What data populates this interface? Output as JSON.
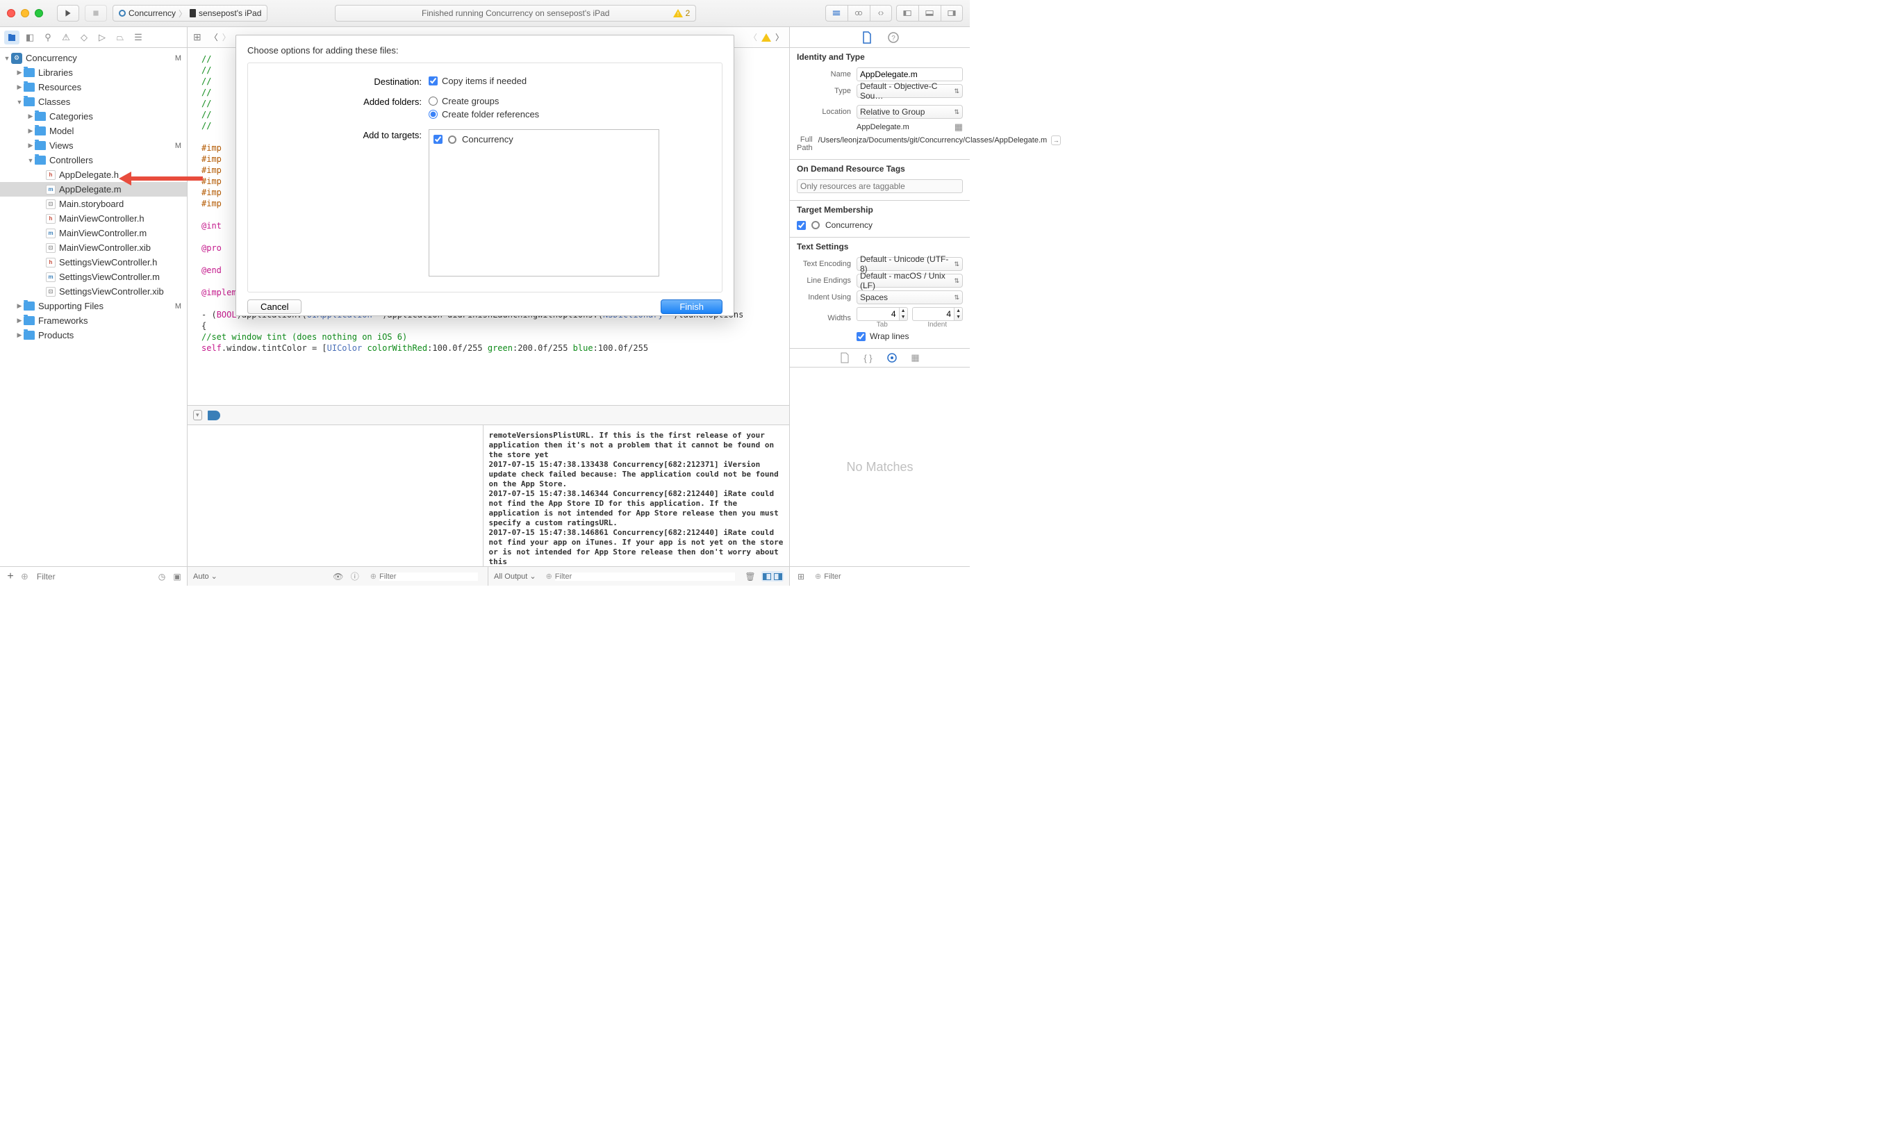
{
  "titlebar": {
    "scheme_target": "Concurrency",
    "scheme_device": "sensepost's iPad",
    "status": "Finished running Concurrency on sensepost's iPad",
    "warning_count": "2"
  },
  "navigator": {
    "project": "Concurrency",
    "project_status": "M",
    "items": [
      {
        "name": "Libraries",
        "level": 1,
        "disclosure": "▶",
        "type": "folder"
      },
      {
        "name": "Resources",
        "level": 1,
        "disclosure": "▶",
        "type": "folder"
      },
      {
        "name": "Classes",
        "level": 1,
        "disclosure": "▼",
        "type": "folder"
      },
      {
        "name": "Categories",
        "level": 2,
        "disclosure": "▶",
        "type": "folder"
      },
      {
        "name": "Model",
        "level": 2,
        "disclosure": "▶",
        "type": "folder"
      },
      {
        "name": "Views",
        "level": 2,
        "disclosure": "▶",
        "type": "folder",
        "status": "M"
      },
      {
        "name": "Controllers",
        "level": 2,
        "disclosure": "▼",
        "type": "folder"
      },
      {
        "name": "AppDelegate.h",
        "level": 3,
        "type": "h"
      },
      {
        "name": "AppDelegate.m",
        "level": 3,
        "type": "m",
        "selected": true
      },
      {
        "name": "Main.storyboard",
        "level": 3,
        "type": "x"
      },
      {
        "name": "MainViewController.h",
        "level": 3,
        "type": "h"
      },
      {
        "name": "MainViewController.m",
        "level": 3,
        "type": "m"
      },
      {
        "name": "MainViewController.xib",
        "level": 3,
        "type": "x"
      },
      {
        "name": "SettingsViewController.h",
        "level": 3,
        "type": "h"
      },
      {
        "name": "SettingsViewController.m",
        "level": 3,
        "type": "m"
      },
      {
        "name": "SettingsViewController.xib",
        "level": 3,
        "type": "x"
      },
      {
        "name": "Supporting Files",
        "level": 1,
        "disclosure": "▶",
        "type": "folder",
        "status": "M"
      },
      {
        "name": "Frameworks",
        "level": 1,
        "disclosure": "▶",
        "type": "folder"
      },
      {
        "name": "Products",
        "level": 1,
        "disclosure": "▶",
        "type": "folder"
      }
    ],
    "filter_placeholder": "Filter"
  },
  "dialog": {
    "title": "Choose options for adding these files:",
    "destination_label": "Destination:",
    "copy_items": "Copy items if needed",
    "added_folders_label": "Added folders:",
    "create_groups": "Create groups",
    "create_refs": "Create folder references",
    "add_targets_label": "Add to targets:",
    "target": "Concurrency",
    "cancel": "Cancel",
    "finish": "Finish"
  },
  "editor": {
    "lines": "//\n//\n//\n//\n//\n//\n//\n\n#imp\n#imp\n#imp\n#imp\n#imp\n#imp\n\n@int\n\n@pro\n\n@end\n\n@implementation AppDelegate\n\n",
    "method_sig_1": "- (",
    "type_bool": "BOOL",
    "method_sig_2": ")application:(",
    "type_uiapp": "UIApplication",
    "method_sig_3": " *)application didFinishLaunchingWithOptions:(",
    "type_nsdict": "NSDictionary",
    "method_sig_4": " *)launchOptions",
    "brace": "{",
    "comment_tint": "    //set window tint (does nothing on iOS 6)",
    "tint_1": "    ",
    "tint_self": "self",
    "tint_2": ".window.tintColor = [",
    "tint_uicolor": "UIColor",
    "tint_3": " ",
    "tint_method": "colorWithRed",
    "tint_4": ":100.0f/255 ",
    "tint_green": "green",
    "tint_5": ":200.0f/255 ",
    "tint_blue": "blue",
    "tint_6": ":100.0f/255"
  },
  "debug": {
    "auto_label": "Auto ⌄",
    "vars_filter": "Filter",
    "output_label": "All Output ⌄",
    "console_filter": "Filter",
    "console": "remoteVersionsPlistURL. If this is the first release of your application then it's not a problem that it cannot be found on the store yet\n2017-07-15 15:47:38.133438 Concurrency[682:212371] iVersion update check failed because: The application could not be found on the App Store.\n2017-07-15 15:47:38.146344 Concurrency[682:212440] iRate could not find the App Store ID for this application. If the application is not intended for App Store release then you must specify a custom ratingsURL.\n2017-07-15 15:47:38.146861 Concurrency[682:212440] iRate could not find your app on iTunes. If your app is not yet on the store or is not intended for App Store release then don't worry about this"
  },
  "inspector": {
    "identity_title": "Identity and Type",
    "name_label": "Name",
    "name_value": "AppDelegate.m",
    "type_label": "Type",
    "type_value": "Default - Objective-C Sou…",
    "location_label": "Location",
    "location_value": "Relative to Group",
    "location_file": "AppDelegate.m",
    "fullpath_label": "Full Path",
    "fullpath_value": "/Users/leonjza/Documents/git/Concurrency/Classes/AppDelegate.m",
    "tags_title": "On Demand Resource Tags",
    "tags_placeholder": "Only resources are taggable",
    "membership_title": "Target Membership",
    "membership_target": "Concurrency",
    "text_settings_title": "Text Settings",
    "encoding_label": "Text Encoding",
    "encoding_value": "Default - Unicode (UTF-8)",
    "endings_label": "Line Endings",
    "endings_value": "Default - macOS / Unix (LF)",
    "indent_using_label": "Indent Using",
    "indent_using_value": "Spaces",
    "widths_label": "Widths",
    "tab_value": "4",
    "tab_label": "Tab",
    "indent_value": "4",
    "indent_label": "Indent",
    "wrap_label": "Wrap lines",
    "no_matches": "No Matches",
    "lib_filter": "Filter"
  }
}
